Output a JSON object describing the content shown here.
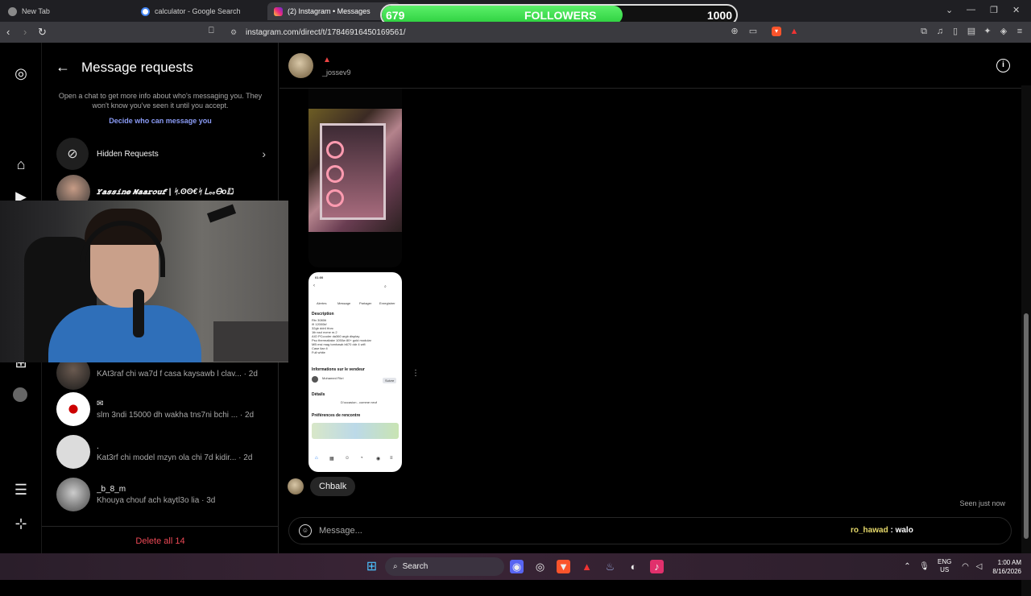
{
  "browser": {
    "tabs": [
      {
        "title": "New Tab",
        "active": false
      },
      {
        "title": "calculator - Google Search",
        "active": false
      },
      {
        "title": "(2) Instagram • Messages",
        "active": true
      }
    ],
    "url": "instagram.com/direct/t/17846916450169561/"
  },
  "followers_overlay": {
    "current": "679",
    "label": "FOLLOWERS",
    "goal": "1000",
    "progress": 0.679
  },
  "sidebar": {
    "title": "Message requests",
    "info_text": "Open a chat to get more info about who's messaging you. They won't know you've seen it until you accept.",
    "decide_link": "Decide who can message you",
    "hidden_requests_label": "Hidden Requests",
    "conversations": [
      {
        "name": "𝒀𝒂𝒔𝒔𝒊𝒏𝒆 𝑴𝒂𝒂𝒓𝒐𝒖𝒇 | ᛋ.ʘʘ€ᛋ ᏞₑₑᎾᴏ𝕀ℷ",
        "preview": ""
      },
      {
        "name": "",
        "preview": "KAt3raf chi wa7d f casa kaysawb l clav... · 2d"
      },
      {
        "name": "",
        "preview": "slm 3ndi 15000 dh wakha tns7ni bchi ... · 2d"
      },
      {
        "name": ".",
        "preview": "Kat3rf chi model mzyn ola chi 7d kidir... · 2d"
      },
      {
        "name": "_b_8_m",
        "preview": "Khouya chouf ach kaytl3o lia · 3d"
      }
    ],
    "delete_all": "Delete all 14"
  },
  "chat": {
    "username": "_jossev9",
    "message_text": "Chbalk",
    "seen_status": "Seen just now",
    "composer_placeholder": "Message...",
    "listing_screenshot": {
      "time": "01:00",
      "actions": [
        "Alertes",
        "Message",
        "Partager",
        "Enregistrer"
      ],
      "description_title": "Description",
      "description_lines": [
        "Rtx 3080ti",
        "i9 12000kf",
        "32gb ddr4 tforc",
        "1tb ssd nvme m.2",
        "AIO PCcooler da360 argb display",
        "Psu thermaltake 1050w 80+ gold modular",
        "MB msi mag tomhawk b670 ddr 4 wifi",
        "Case lian li",
        "Full white"
      ],
      "seller_title": "Informations sur le vendeur",
      "seller_name": "Mohamed Fikri",
      "seller_follow": "Suivre",
      "details_title": "Détails",
      "details_state": "D'occasion - comme neuf",
      "meet_title": "Préférences de rencontre"
    }
  },
  "stream_chat": {
    "user": "ro_hawad",
    "message": "walo"
  },
  "taskbar": {
    "search_label": "Search",
    "lang_top": "ENG",
    "lang_bottom": "US",
    "time": "1:00 AM",
    "date": "8/16/2026"
  }
}
